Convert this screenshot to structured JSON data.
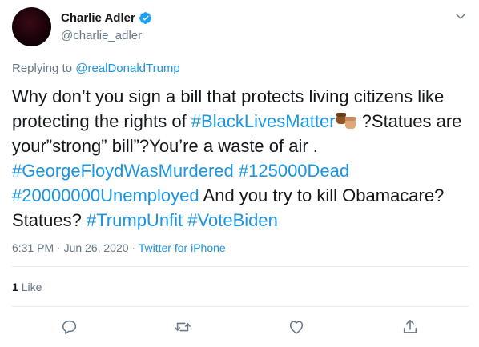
{
  "author": {
    "name": "Charlie Adler",
    "handle": "@charlie_adler",
    "verified": true
  },
  "reply": {
    "prefix": "Replying to ",
    "mention": "@realDonaldTrump"
  },
  "tweet": {
    "t1": "Why don’t you sign a bill that protects living citizens like protecting the rights of ",
    "tag_blm": "#BlackLivesMatter",
    "t2": " ?Statues are your”strong” bill”?You’re a waste of air . ",
    "tag_floyd": "#GeorgeFloydWasMurdered",
    "tag_dead": "#125000Dead",
    "tag_unemployed": "#20000000Unemployed",
    "t3": "  And you try to kill Obamacare? Statues? ",
    "tag_unfit": "#TrumpUnfit",
    "tag_biden": "#VoteBiden"
  },
  "meta": {
    "time": "6:31 PM · Jun 26, 2020 · ",
    "source": "Twitter for iPhone"
  },
  "likes": {
    "count": "1",
    "label": "Like"
  },
  "icons": {
    "reply": "reply-icon",
    "retweet": "retweet-icon",
    "like": "like-icon",
    "share": "share-icon",
    "verified": "verified-badge-icon",
    "more": "chevron-down-icon",
    "emoji": "raised-fists-emoji"
  },
  "colors": {
    "link": "#1b95e0",
    "secondary": "#657786",
    "divider": "#e6ecf0"
  }
}
